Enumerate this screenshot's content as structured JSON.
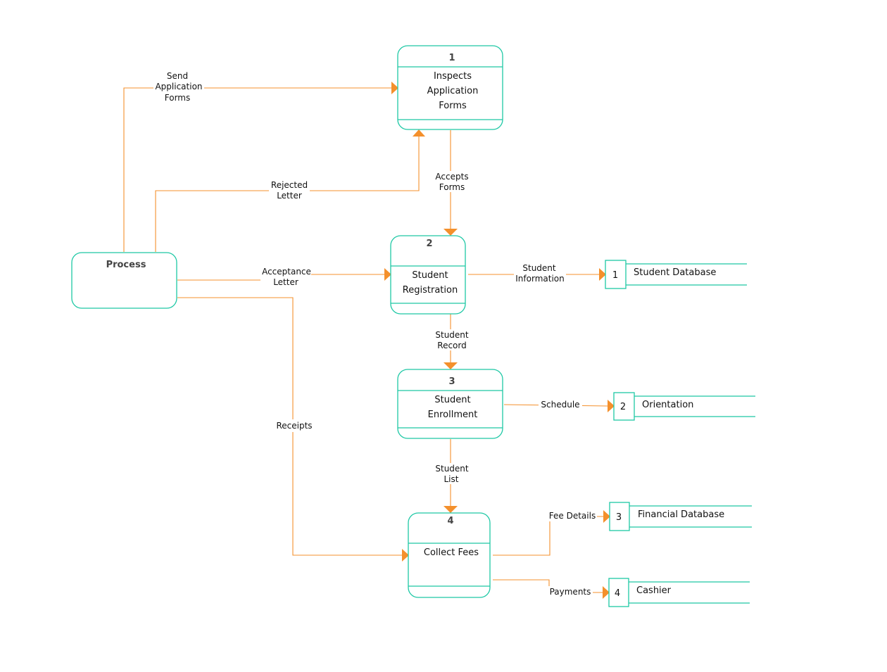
{
  "colors": {
    "process_border": "#1ec8a5",
    "flow": "#f4902c"
  },
  "external": {
    "label": "Process"
  },
  "processes": [
    {
      "number": "1",
      "lines": [
        "Inspects",
        "Application",
        "Forms"
      ]
    },
    {
      "number": "2",
      "lines": [
        "Student",
        "Registration"
      ]
    },
    {
      "number": "3",
      "lines": [
        "Student",
        "Enrollment"
      ]
    },
    {
      "number": "4",
      "lines": [
        "Collect Fees"
      ]
    }
  ],
  "stores": [
    {
      "number": "1",
      "name": "Student Database"
    },
    {
      "number": "2",
      "name": "Orientation"
    },
    {
      "number": "3",
      "name": "Financial Database"
    },
    {
      "number": "4",
      "name": "Cashier"
    }
  ],
  "flows": {
    "send_forms": [
      "Send",
      "Application",
      "Forms"
    ],
    "rejected": [
      "Rejected",
      "Letter"
    ],
    "accepts": [
      "Accepts",
      "Forms"
    ],
    "acceptance": [
      "Acceptance",
      "Letter"
    ],
    "student_info": [
      "Student",
      "Information"
    ],
    "student_record": [
      "Student",
      "Record"
    ],
    "schedule": "Schedule",
    "student_list": [
      "Student",
      "List"
    ],
    "receipts": "Receipts",
    "fee_details": "Fee Details",
    "payments": "Payments"
  }
}
